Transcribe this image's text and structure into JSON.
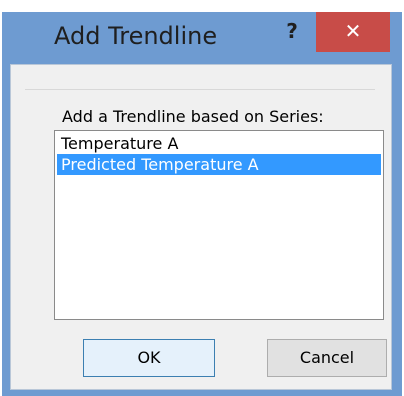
{
  "dialog": {
    "title": "Add Trendline",
    "help_glyph": "?",
    "close_glyph": "✕",
    "prompt": "Add a Trendline based on Series:",
    "series": [
      {
        "label": "Temperature A",
        "selected": false
      },
      {
        "label": "Predicted Temperature A",
        "selected": true
      }
    ],
    "ok_label": "OK",
    "cancel_label": "Cancel"
  },
  "colors": {
    "title_bar": "#6e9bd1",
    "close_button": "#c84c48",
    "selection": "#3399ff"
  }
}
